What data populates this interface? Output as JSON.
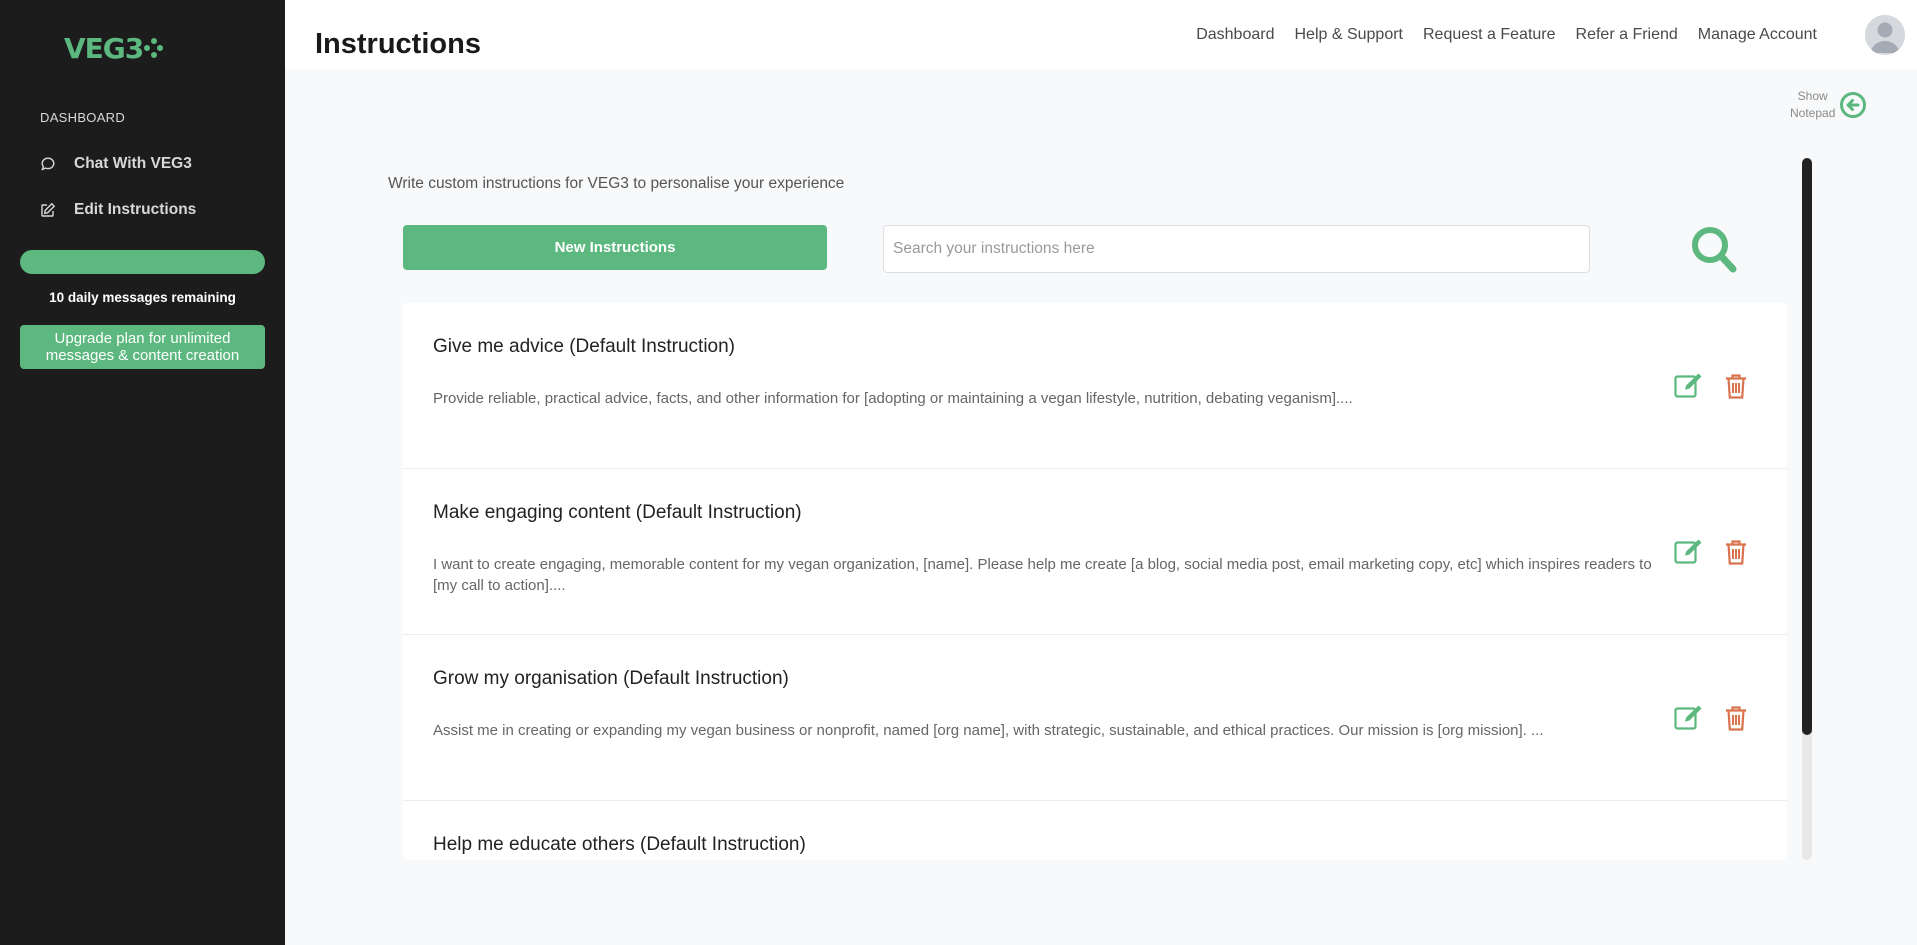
{
  "brand": {
    "logo_text": "VEG3",
    "accent": "#5cb87f",
    "sidebar_bg": "#1c1c1c",
    "delete_color": "#d9734e"
  },
  "sidebar": {
    "section_label": "DASHBOARD",
    "items": [
      {
        "label": "Chat With VEG3",
        "icon": "chat-bubble-icon"
      },
      {
        "label": "Edit Instructions",
        "icon": "edit-square-icon"
      }
    ],
    "usage_fraction": 1.0,
    "remaining_text": "10 daily messages remaining",
    "upgrade_label": "Upgrade plan for unlimited messages & content creation"
  },
  "header": {
    "title": "Instructions",
    "nav": [
      "Dashboard",
      "Help & Support",
      "Request a Feature",
      "Refer a Friend",
      "Manage Account"
    ],
    "avatar_icon": "user-avatar-icon"
  },
  "notepad": {
    "line1": "Show",
    "line2": "Notepad",
    "icon": "arrow-left-circle-icon"
  },
  "main": {
    "intro": "Write custom instructions for VEG3 to personalise your experience",
    "new_button": "New Instructions",
    "search_placeholder": "Search your instructions here",
    "search_icon": "search-icon"
  },
  "instructions": [
    {
      "title": "Give me advice (Default Instruction)",
      "desc": "Provide reliable, practical advice, facts, and other information for [adopting or maintaining a vegan lifestyle, nutrition, debating veganism]...."
    },
    {
      "title": "Make engaging content (Default Instruction)",
      "desc": "I want to create engaging, memorable content for my vegan organization, [name]. Please help me create [a blog, social media post, email marketing copy, etc] which inspires readers to [my call to action]...."
    },
    {
      "title": "Grow my organisation (Default Instruction)",
      "desc": "Assist me in creating or expanding my vegan business or nonprofit, named [org name], with strategic, sustainable, and ethical practices. Our mission is [org mission]. ..."
    },
    {
      "title": "Help me educate others (Default Instruction)",
      "desc": ""
    }
  ]
}
